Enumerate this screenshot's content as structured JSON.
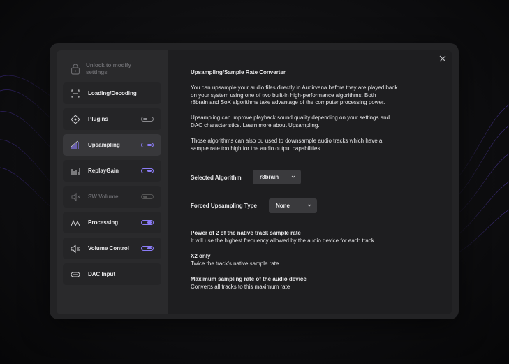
{
  "sidebar": {
    "lock_text": "Unlock to modify settings",
    "items": [
      {
        "label": "Loading/Decoding",
        "icon": "loading-icon",
        "toggle": null
      },
      {
        "label": "Plugins",
        "icon": "plugins-icon",
        "toggle": "off"
      },
      {
        "label": "Upsampling",
        "icon": "upsampling-icon",
        "toggle": "on"
      },
      {
        "label": "ReplayGain",
        "icon": "replaygain-icon",
        "toggle": "on"
      },
      {
        "label": "SW Volume",
        "icon": "volume-icon",
        "toggle": "disabled"
      },
      {
        "label": "Processing",
        "icon": "processing-icon",
        "toggle": "on"
      },
      {
        "label": "Volume  Control",
        "icon": "volume-control-icon",
        "toggle": "on"
      },
      {
        "label": "DAC Input",
        "icon": "dac-input-icon",
        "toggle": null
      }
    ],
    "active_index": 2
  },
  "main": {
    "title": "Upsampling/Sample Rate Converter",
    "para1": [
      "You can upsample your audio files directly in Audirvana before they are played back",
      "on your system using one of two built-in high-performance algorithms. Both",
      "r8brain and SoX algorithms take advantage of the computer processing power."
    ],
    "para2": [
      "Upsampling can improve playback sound quality depending on your settings and",
      "DAC characteristics. Learn more about Upsampling."
    ],
    "para3": [
      "Those algorithms can also bu used to downsample audio tracks which have a",
      "sample rate too high for the audio output capabilities."
    ],
    "algorithm": {
      "label": "Selected Algorithm",
      "value": "r8brain"
    },
    "forced": {
      "label": "Forced Upsampling Type",
      "value": "None"
    },
    "options": [
      {
        "title": "Power of 2 of the native track sample rate",
        "desc": "It will use the highest frequency allowed by the audio device for each track"
      },
      {
        "title": "X2 only",
        "desc": "Twice the track's native sample rate"
      },
      {
        "title": "Maximum sampling rate of the audio device",
        "desc": "Converts all tracks to this maximum rate"
      }
    ]
  },
  "colors": {
    "accent": "#8b7cf6",
    "panel": "#1e1e20",
    "sidebar": "#2a2a2c"
  }
}
